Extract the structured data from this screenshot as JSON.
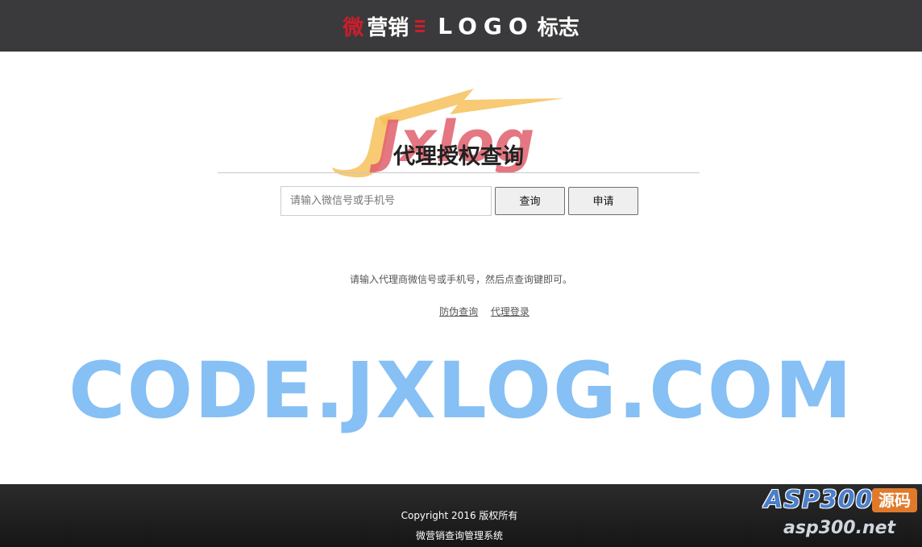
{
  "header": {
    "logo_red_char": "微",
    "logo_brand": "营销",
    "logo_word": "LOGO",
    "logo_tag": "标志"
  },
  "watermark_logo": {
    "text": "Jxlog",
    "bolt_color": "#f6c15a",
    "text_color": "#e0606c"
  },
  "main": {
    "title": "代理授权查询",
    "search_placeholder": "请输入微信号或手机号",
    "query_button": "查询",
    "apply_button": "申请",
    "hint": "请输入代理商微信号或手机号，然后点查询键即可。",
    "links": [
      {
        "label": "防伪查询"
      },
      {
        "label": "代理登录"
      }
    ]
  },
  "big_watermark": {
    "text": "CODE.JXLOG.COM",
    "color": "#86c0f4"
  },
  "footer": {
    "copyright": "Copyright 2016 版权所有",
    "system_name": "微营销查询管理系统",
    "badge_asp": "ASP300",
    "badge_yuan": "源码",
    "badge_net": "asp300.net"
  },
  "colors": {
    "header_bg": "#3a3a3c",
    "accent_red": "#d01c2c",
    "footer_bg": "#1e1e1e"
  }
}
